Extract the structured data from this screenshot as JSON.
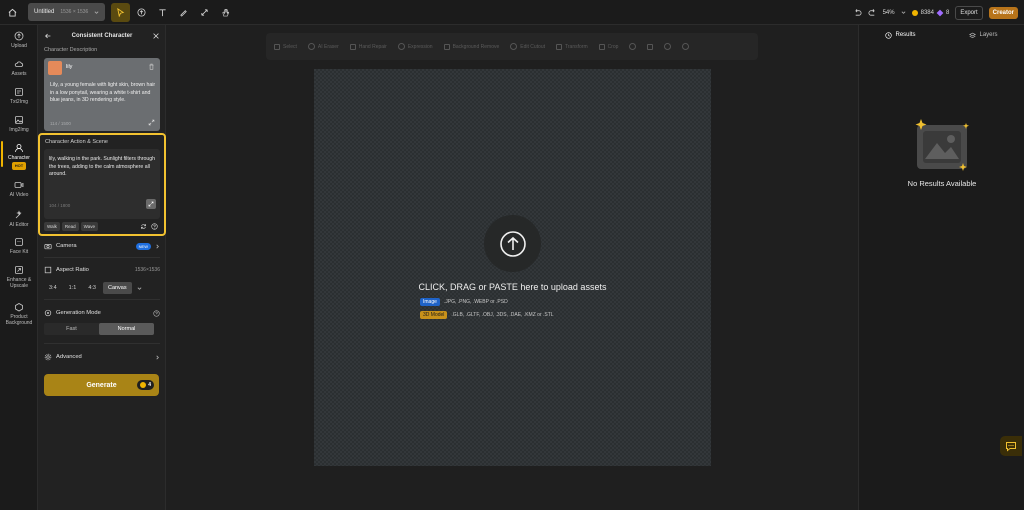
{
  "topbar": {
    "doc_name": "Untitled",
    "doc_size": "1536 × 1536",
    "zoom": "54%",
    "coins": "8384",
    "gems": "8",
    "export_label": "Export",
    "creator_label": "Creator",
    "colors": {
      "accent": "#f0b400",
      "creator": "#b8741a"
    }
  },
  "rail": {
    "items": [
      {
        "label": "Upload",
        "icon": "upload-icon"
      },
      {
        "label": "Assets",
        "icon": "cloud-icon"
      },
      {
        "label": "Txt2Img",
        "icon": "txt2img-icon"
      },
      {
        "label": "Img2Img",
        "icon": "img2img-icon"
      },
      {
        "label": "Character",
        "icon": "character-icon",
        "badge": "HOT"
      },
      {
        "label": "AI Video",
        "icon": "video-icon"
      },
      {
        "label": "AI Editor",
        "icon": "editor-icon"
      },
      {
        "label": "Face Kit",
        "icon": "face-icon"
      },
      {
        "label": "Enhance & Upscale",
        "icon": "enhance-icon"
      },
      {
        "label": "Product Background",
        "icon": "product-icon"
      }
    ]
  },
  "panel": {
    "title": "Consistent Character",
    "desc_section": "Character Description",
    "character_name": "lily",
    "character_desc": "Lily, a young female with light skin, brown hair in a low ponytail, wearing a white t-shirt and blue jeans, in 3D rendering style.",
    "desc_count": "114 / 1500",
    "scene_section": "Character Action & Scene",
    "scene_text": "lily, walking in the park. Sunlight filters through the trees, adding to the calm atmosphere all around.",
    "scene_count": "104 / 1800",
    "chips": [
      "Walk",
      "Read",
      "Wave"
    ],
    "camera_label": "Camera",
    "camera_badge": "NEW",
    "aspect_label": "Aspect Ratio",
    "aspect_size": "1536×1536",
    "ratios": [
      "3:4",
      "1:1",
      "4:3",
      "Canvas"
    ],
    "selected_ratio": "Canvas",
    "mode_label": "Generation Mode",
    "modes": [
      "Fast",
      "Normal"
    ],
    "selected_mode": "Normal",
    "advanced_label": "Advanced",
    "generate_label": "Generate",
    "generate_cost": "4"
  },
  "canvas_toolbar": {
    "items": [
      "Select",
      "AI Eraser",
      "Hand Repair",
      "Expression",
      "Background Remove",
      "Edit Cutout",
      "Transform",
      "Crop"
    ]
  },
  "canvas": {
    "upload_title": "CLICK, DRAG or PASTE here to upload assets",
    "image_tag": "Image",
    "image_formats": ".JPG, .PNG, .WEBP or .PSD",
    "model_tag": "3D Model",
    "model_formats": ".GLB, .GLTF, .OBJ, .3DS, .DAE, .KMZ or .STL"
  },
  "right_panel": {
    "tab_results": "Results",
    "tab_layers": "Layers",
    "empty_text": "No Results Available"
  }
}
